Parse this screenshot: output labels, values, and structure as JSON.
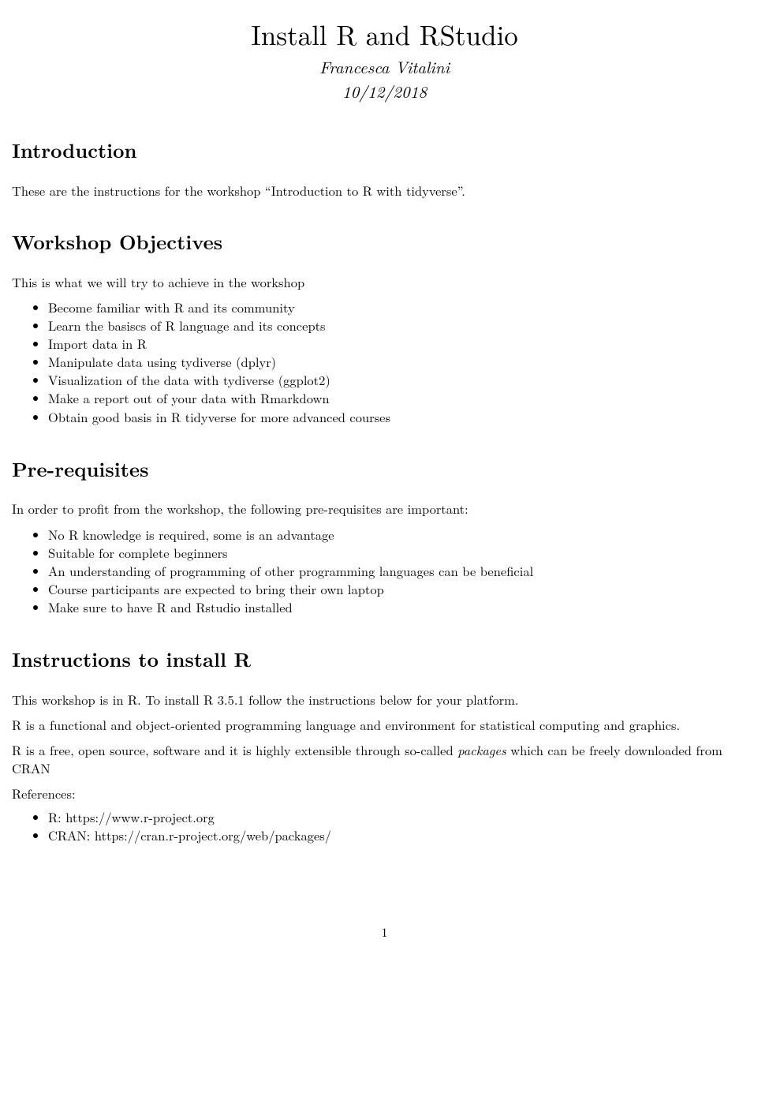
{
  "header": {
    "title": "Install R and RStudio",
    "author": "Francesca Vitalini",
    "date": "10/12/2018"
  },
  "sections": {
    "introduction": {
      "heading": "Introduction",
      "text": "These are the instructions for the workshop “Introduction to R with tidyverse”."
    },
    "objectives": {
      "heading": "Workshop Objectives",
      "intro": "This is what we will try to achieve in the workshop",
      "items": [
        "Become familiar with R and its community",
        "Learn the basiscs of R language and its concepts",
        "Import data in R",
        "Manipulate data using tydiverse (dplyr)",
        "Visualization of the data with tydiverse (ggplot2)",
        "Make a report out of your data with Rmarkdown",
        "Obtain good basis in R tidyverse for more advanced courses"
      ]
    },
    "prerequisites": {
      "heading": "Pre-requisites",
      "intro": "In order to profit from the workshop, the following pre-requisites are important:",
      "items": [
        "No R knowledge is required, some is an advantage",
        "Suitable for complete beginners",
        "An understanding of programming of other programming languages can be beneficial",
        "Course participants are expected to bring their own laptop",
        "Make sure to have R and Rstudio installed"
      ]
    },
    "install": {
      "heading": "Instructions to install R",
      "p1": "This workshop is in R. To install R 3.5.1 follow the instructions below for your platform.",
      "p2": "R is a functional and object-oriented programming language and environment for statistical computing and graphics.",
      "p3_pre": "R is a free, open source, software and it is highly extensible through so-called ",
      "p3_italic": "packages",
      "p3_post": " which can be freely downloaded from CRAN",
      "references_label": "References:",
      "references": [
        "R: https://www.r-project.org",
        "CRAN: https://cran.r-project.org/web/packages/"
      ]
    }
  },
  "page_number": "1"
}
